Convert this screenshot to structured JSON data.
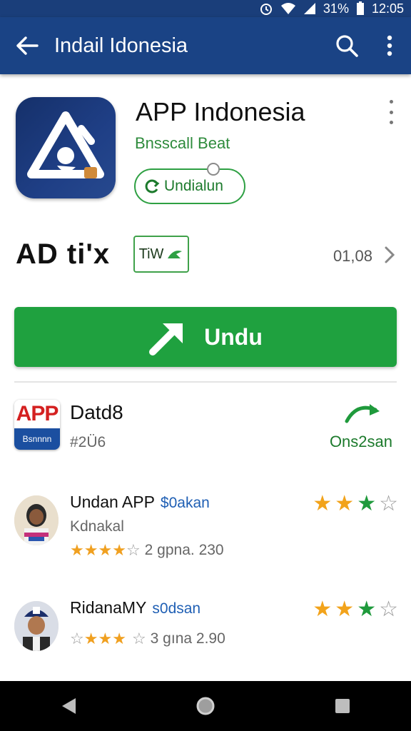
{
  "status_bar": {
    "signal_pct": "31%",
    "time": "12:05"
  },
  "app_bar": {
    "title": "Indail Idonesia"
  },
  "app": {
    "title": "APP Indonesia",
    "subtitle": "Bnsscall Beat",
    "install_pill_label": "Undialun"
  },
  "rating_row": {
    "label": "AD ti'x",
    "badge_text": "TiW",
    "count": "01,08"
  },
  "install_button": {
    "label": "Undu"
  },
  "developer": {
    "icon_top": "APP",
    "icon_bottom": "Bsnnnn",
    "name": "Datd8",
    "meta": "#2Ü6",
    "action_label": "Ons2san"
  },
  "reviews": [
    {
      "name": "Undan APP",
      "tag": "$0akan",
      "sub": "Kdnakal",
      "line": "2  gpna. 230",
      "line_stars": 4,
      "stars": 3
    },
    {
      "name": "RidanaMY",
      "tag": "s0dsan",
      "sub": "",
      "line": "3  gına 2.90",
      "line_stars": 3,
      "stars": 3
    }
  ],
  "colors": {
    "app_bar": "#1a4385",
    "accent_green": "#1fa13f",
    "star_orange": "#f2a31b"
  }
}
